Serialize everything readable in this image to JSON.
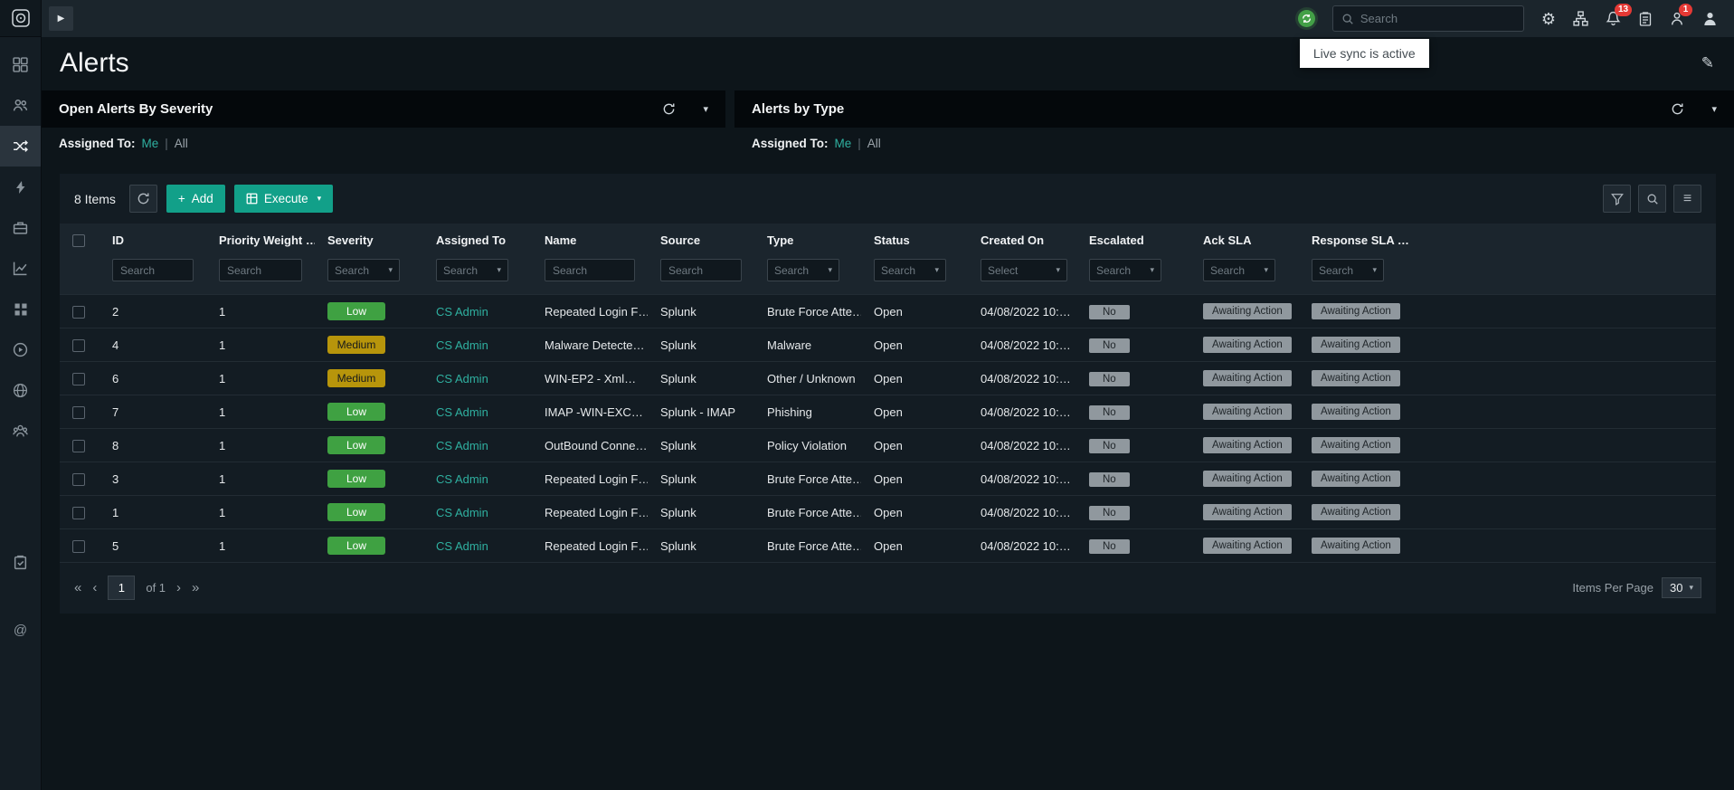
{
  "icons": {
    "play": "▶",
    "plus": "+",
    "caret_down": "▾",
    "gear": "⚙",
    "menu": "≡",
    "pencil": "✎",
    "at": "@",
    "pipe": "|",
    "first": "«",
    "prev": "‹",
    "next": "›",
    "last": "»"
  },
  "topbar": {
    "search_placeholder": "Search",
    "notifications_count": "13",
    "user_alerts_count": "1",
    "live_sync_tooltip": "Live sync is active"
  },
  "page": {
    "title": "Alerts"
  },
  "widgets": [
    {
      "title": "Open Alerts By Severity",
      "assigned_to_label": "Assigned To:",
      "filter_me": "Me",
      "filter_all": "All"
    },
    {
      "title": "Alerts by Type",
      "assigned_to_label": "Assigned To:",
      "filter_me": "Me",
      "filter_all": "All"
    }
  ],
  "toolbar": {
    "items_count": "8 Items",
    "add_label": "Add",
    "execute_label": "Execute"
  },
  "table": {
    "columns": [
      "ID",
      "Priority Weight …",
      "Severity",
      "Assigned To",
      "Name",
      "Source",
      "Type",
      "Status",
      "Created On",
      "Escalated",
      "Ack SLA",
      "Response SLA …"
    ],
    "filter_placeholders": [
      "Search",
      "Search",
      "Search",
      "Search",
      "Search",
      "Search",
      "Search",
      "Search",
      "Select",
      "Search",
      "Search",
      "Search"
    ],
    "severity_colors": {
      "low_bg": "#3fa142",
      "low_fg": "#ffffff",
      "medium_bg": "#b7950b",
      "medium_fg": "#16191c"
    },
    "rows": [
      {
        "id": "2",
        "priority_weight": "1",
        "severity": "Low",
        "severity_bg": "#3fa142",
        "severity_fg": "#ffffff",
        "assigned_to": "CS Admin",
        "name": "Repeated Login F…",
        "source": "Splunk",
        "type": "Brute Force Atte…",
        "status": "Open",
        "created_on": "04/08/2022 10:…",
        "escalated": "No",
        "ack_sla": "Awaiting Action",
        "response_sla": "Awaiting Action"
      },
      {
        "id": "4",
        "priority_weight": "1",
        "severity": "Medium",
        "severity_bg": "#b7950b",
        "severity_fg": "#16191c",
        "assigned_to": "CS Admin",
        "name": "Malware Detecte…",
        "source": "Splunk",
        "type": "Malware",
        "status": "Open",
        "created_on": "04/08/2022 10:…",
        "escalated": "No",
        "ack_sla": "Awaiting Action",
        "response_sla": "Awaiting Action"
      },
      {
        "id": "6",
        "priority_weight": "1",
        "severity": "Medium",
        "severity_bg": "#b7950b",
        "severity_fg": "#16191c",
        "assigned_to": "CS Admin",
        "name": "WIN-EP2 - Xml…",
        "source": "Splunk",
        "type": "Other / Unknown",
        "status": "Open",
        "created_on": "04/08/2022 10:…",
        "escalated": "No",
        "ack_sla": "Awaiting Action",
        "response_sla": "Awaiting Action"
      },
      {
        "id": "7",
        "priority_weight": "1",
        "severity": "Low",
        "severity_bg": "#3fa142",
        "severity_fg": "#ffffff",
        "assigned_to": "CS Admin",
        "name": "IMAP -WIN-EXC…",
        "source": "Splunk - IMAP",
        "type": "Phishing",
        "status": "Open",
        "created_on": "04/08/2022 10:…",
        "escalated": "No",
        "ack_sla": "Awaiting Action",
        "response_sla": "Awaiting Action"
      },
      {
        "id": "8",
        "priority_weight": "1",
        "severity": "Low",
        "severity_bg": "#3fa142",
        "severity_fg": "#ffffff",
        "assigned_to": "CS Admin",
        "name": "OutBound Conne…",
        "source": "Splunk",
        "type": "Policy Violation",
        "status": "Open",
        "created_on": "04/08/2022 10:…",
        "escalated": "No",
        "ack_sla": "Awaiting Action",
        "response_sla": "Awaiting Action"
      },
      {
        "id": "3",
        "priority_weight": "1",
        "severity": "Low",
        "severity_bg": "#3fa142",
        "severity_fg": "#ffffff",
        "assigned_to": "CS Admin",
        "name": "Repeated Login F…",
        "source": "Splunk",
        "type": "Brute Force Atte…",
        "status": "Open",
        "created_on": "04/08/2022 10:…",
        "escalated": "No",
        "ack_sla": "Awaiting Action",
        "response_sla": "Awaiting Action"
      },
      {
        "id": "1",
        "priority_weight": "1",
        "severity": "Low",
        "severity_bg": "#3fa142",
        "severity_fg": "#ffffff",
        "assigned_to": "CS Admin",
        "name": "Repeated Login F…",
        "source": "Splunk",
        "type": "Brute Force Atte…",
        "status": "Open",
        "created_on": "04/08/2022 10:…",
        "escalated": "No",
        "ack_sla": "Awaiting Action",
        "response_sla": "Awaiting Action"
      },
      {
        "id": "5",
        "priority_weight": "1",
        "severity": "Low",
        "severity_bg": "#3fa142",
        "severity_fg": "#ffffff",
        "assigned_to": "CS Admin",
        "name": "Repeated Login F…",
        "source": "Splunk",
        "type": "Brute Force Atte…",
        "status": "Open",
        "created_on": "04/08/2022 10:…",
        "escalated": "No",
        "ack_sla": "Awaiting Action",
        "response_sla": "Awaiting Action"
      }
    ]
  },
  "pagination": {
    "current_page": "1",
    "of_label": "of 1",
    "items_per_page_label": "Items Per Page",
    "items_per_page_value": "30"
  }
}
